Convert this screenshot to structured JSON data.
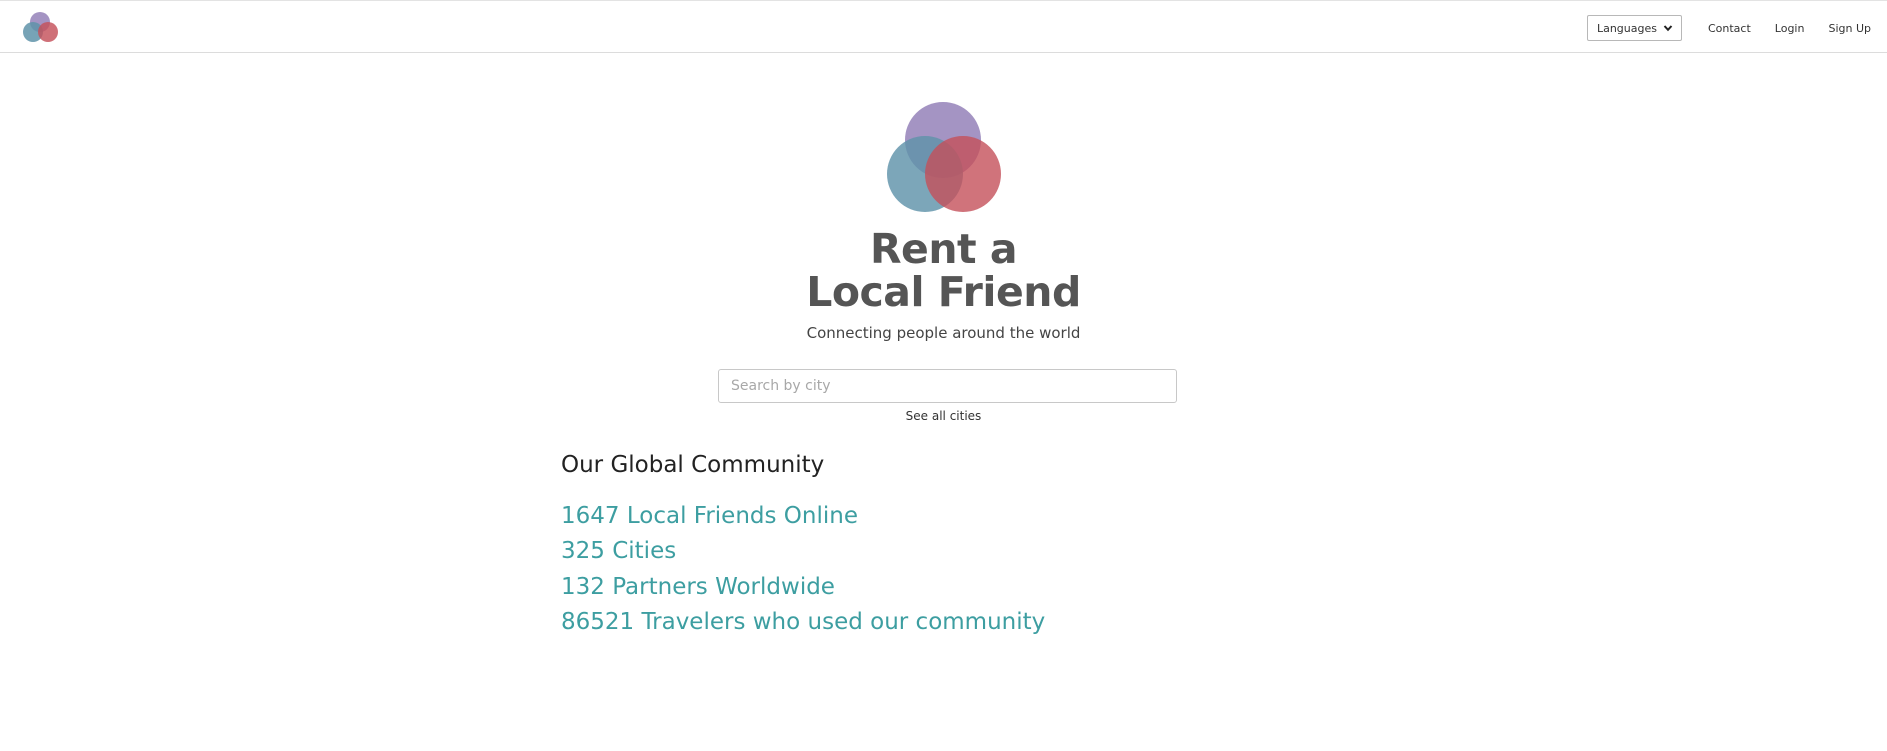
{
  "header": {
    "logo_icon": "overlapping-circles-logo",
    "languages_label": "Languages",
    "nav": {
      "contact": "Contact",
      "login": "Login",
      "signup": "Sign Up"
    }
  },
  "hero": {
    "title_line1": "Rent a",
    "title_line2": "Local Friend",
    "tagline": "Connecting people around the world",
    "colors": {
      "purple": "#9a88bd",
      "blue": "#5f93a9",
      "red": "#c4505a"
    }
  },
  "search": {
    "placeholder": "Search by city",
    "value": "",
    "see_all": "See all cities"
  },
  "community": {
    "title": "Our Global Community",
    "stats": [
      "1647 Local Friends Online",
      "325 Cities",
      "132 Partners Worldwide",
      "86521 Travelers who used our community"
    ],
    "stat_color": "#3d9ea1"
  }
}
